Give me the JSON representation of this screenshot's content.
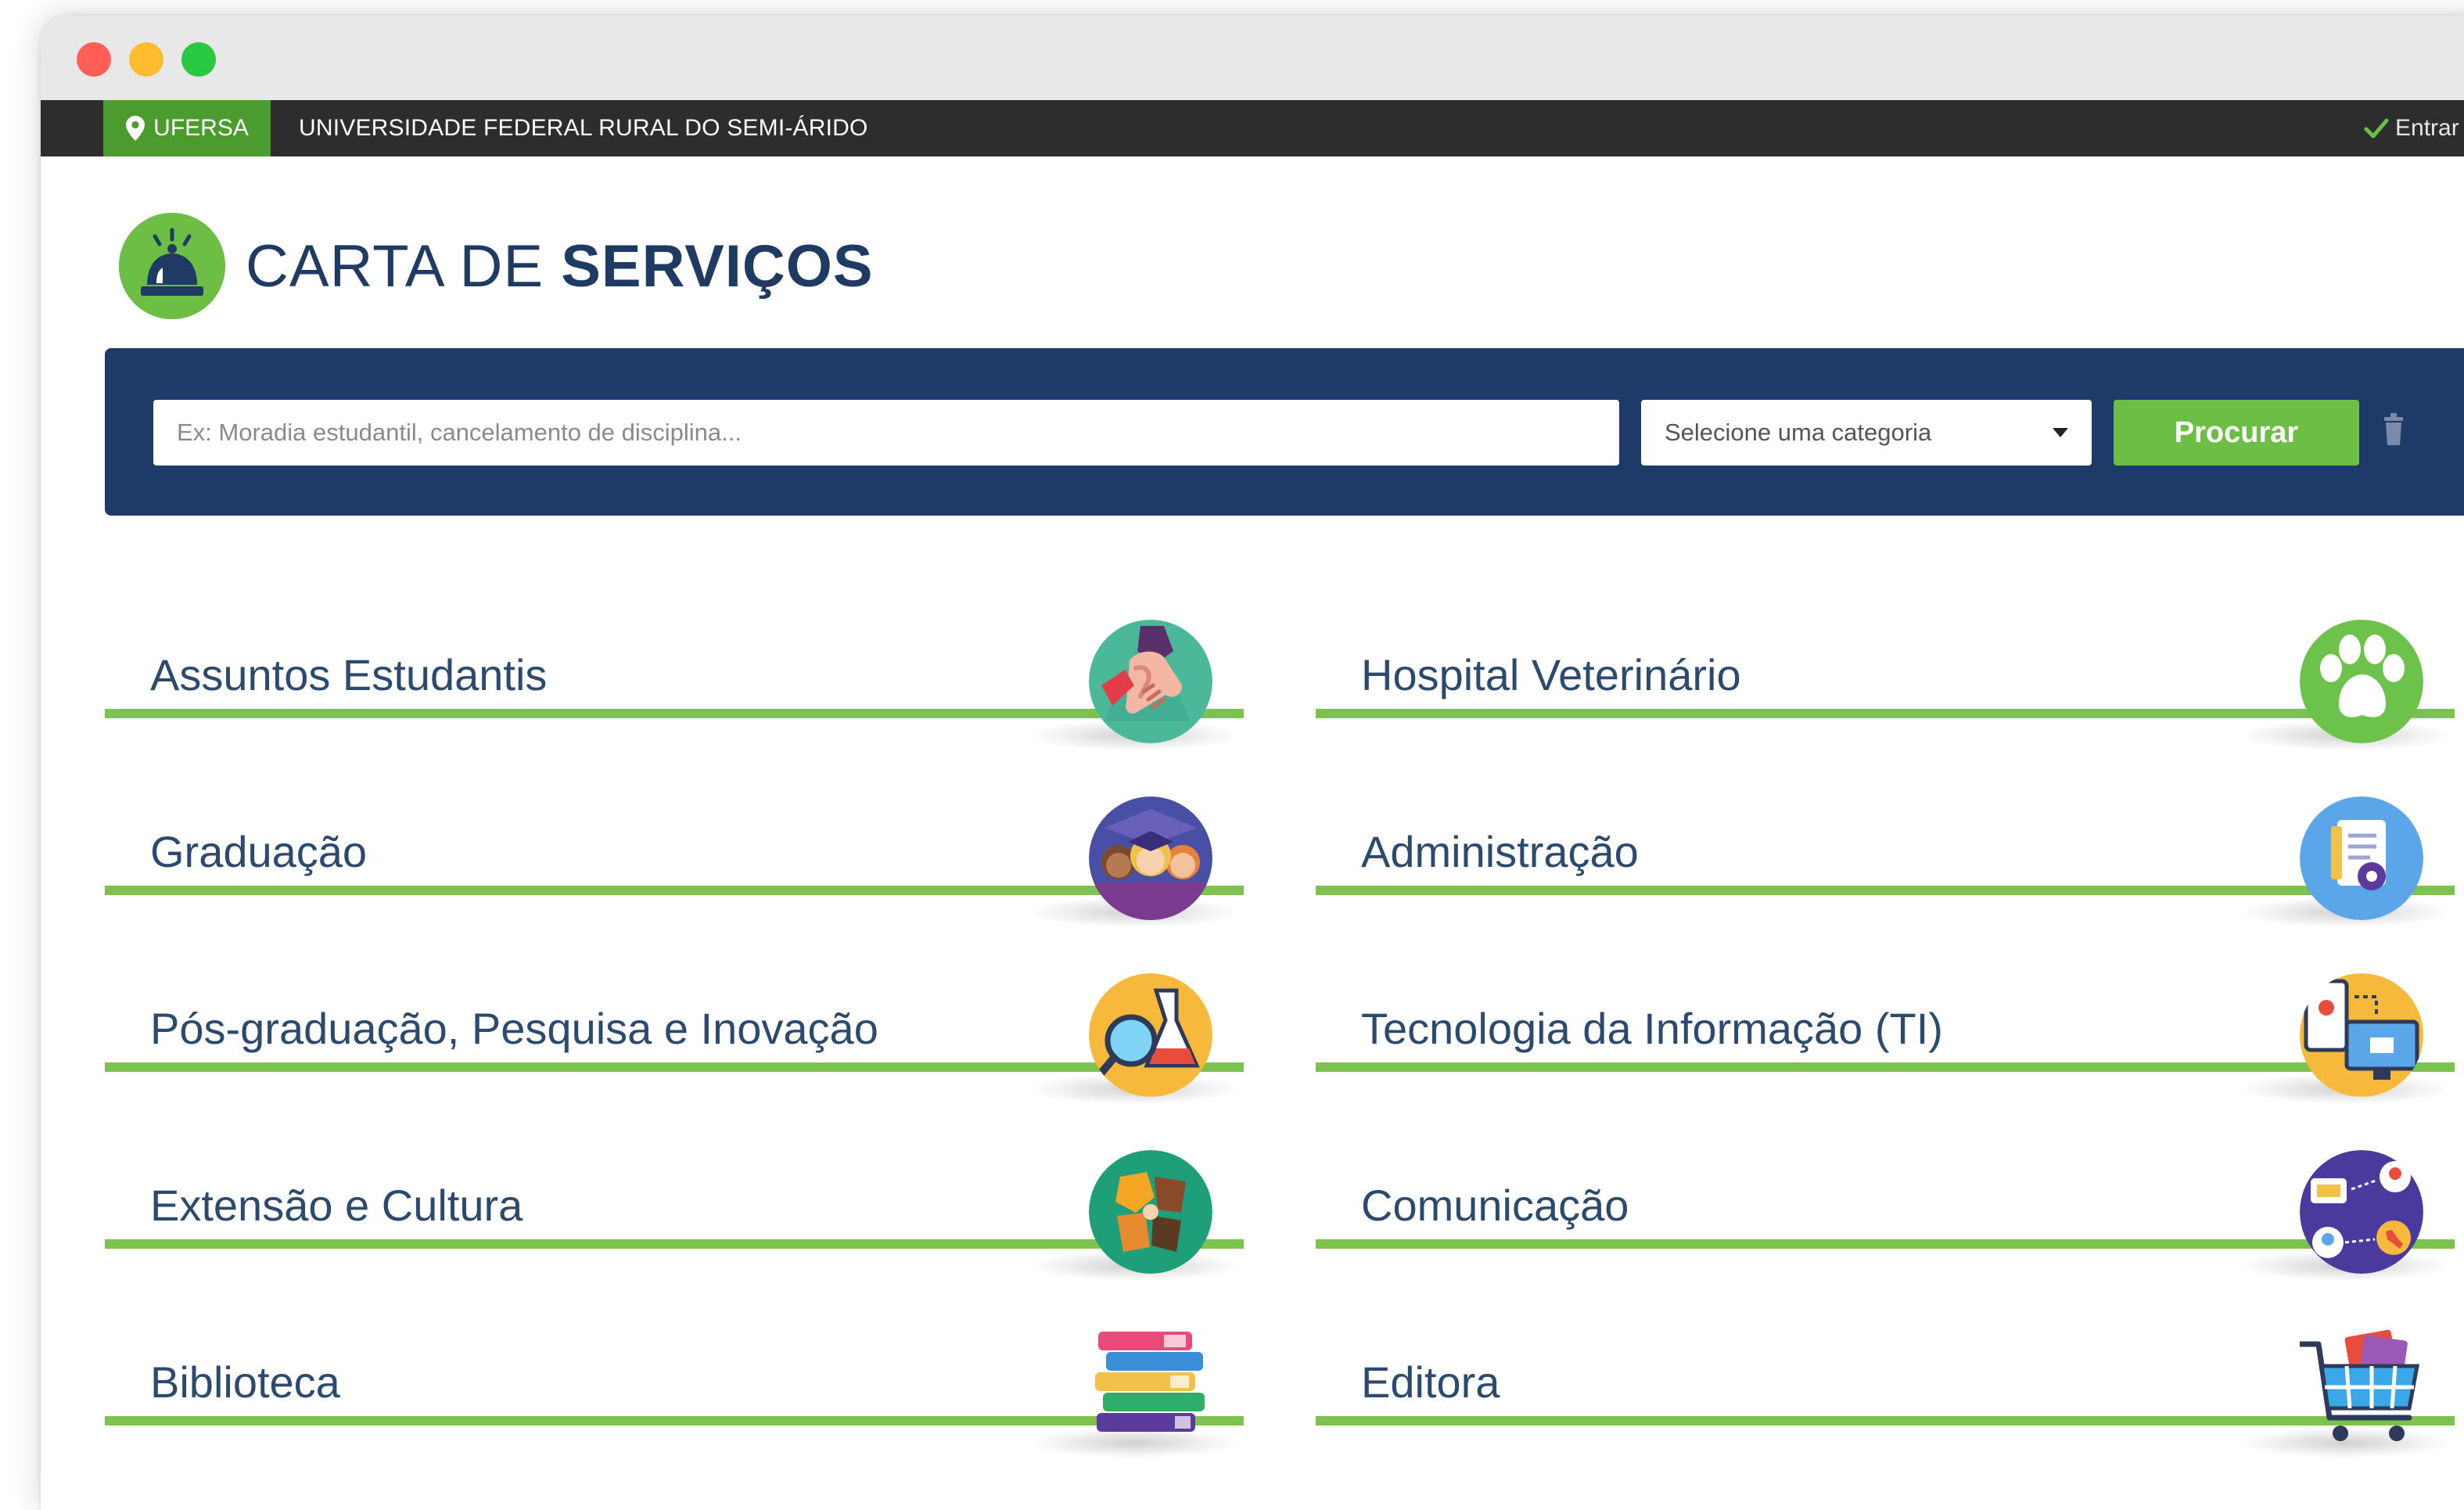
{
  "window": {
    "traffic_lights": [
      "close",
      "minimize",
      "zoom"
    ]
  },
  "topbar": {
    "brand": "UFERSA",
    "brand_icon": "map-pin-icon",
    "university_name": "UNIVERSIDADE FEDERAL RURAL DO SEMI-ÁRIDO",
    "login_label": "Entrar",
    "login_icon": "check-icon"
  },
  "header": {
    "title_light": "CARTA DE",
    "title_bold": "SERVIÇOS",
    "logo_icon": "service-bell-icon"
  },
  "search": {
    "placeholder": "Ex: Moradia estudantil, cancelamento de disciplina...",
    "value": "",
    "category_selected": "Selecione uma categoria",
    "button_label": "Procurar",
    "clear_icon": "trash-icon"
  },
  "colors": {
    "accent_green": "#6cbe45",
    "navy": "#1e3a68",
    "topbar": "#2d2d2d",
    "text_blue": "#2b4a6e"
  },
  "services": [
    {
      "label": "Assuntos Estudantis",
      "icon": "handshake-icon"
    },
    {
      "label": "Hospital Veterinário",
      "icon": "paw-icon"
    },
    {
      "label": "Graduação",
      "icon": "graduates-icon"
    },
    {
      "label": "Administração",
      "icon": "document-gear-icon"
    },
    {
      "label": "Pós-graduação, Pesquisa e Inovação",
      "icon": "magnifier-flask-icon"
    },
    {
      "label": "Tecnologia da Informação (TI)",
      "icon": "devices-icon"
    },
    {
      "label": "Extensão e Cultura",
      "icon": "puzzle-hands-icon"
    },
    {
      "label": "Comunicação",
      "icon": "communication-network-icon"
    },
    {
      "label": "Biblioteca",
      "icon": "books-stack-icon"
    },
    {
      "label": "Editora",
      "icon": "shopping-cart-icon"
    }
  ]
}
